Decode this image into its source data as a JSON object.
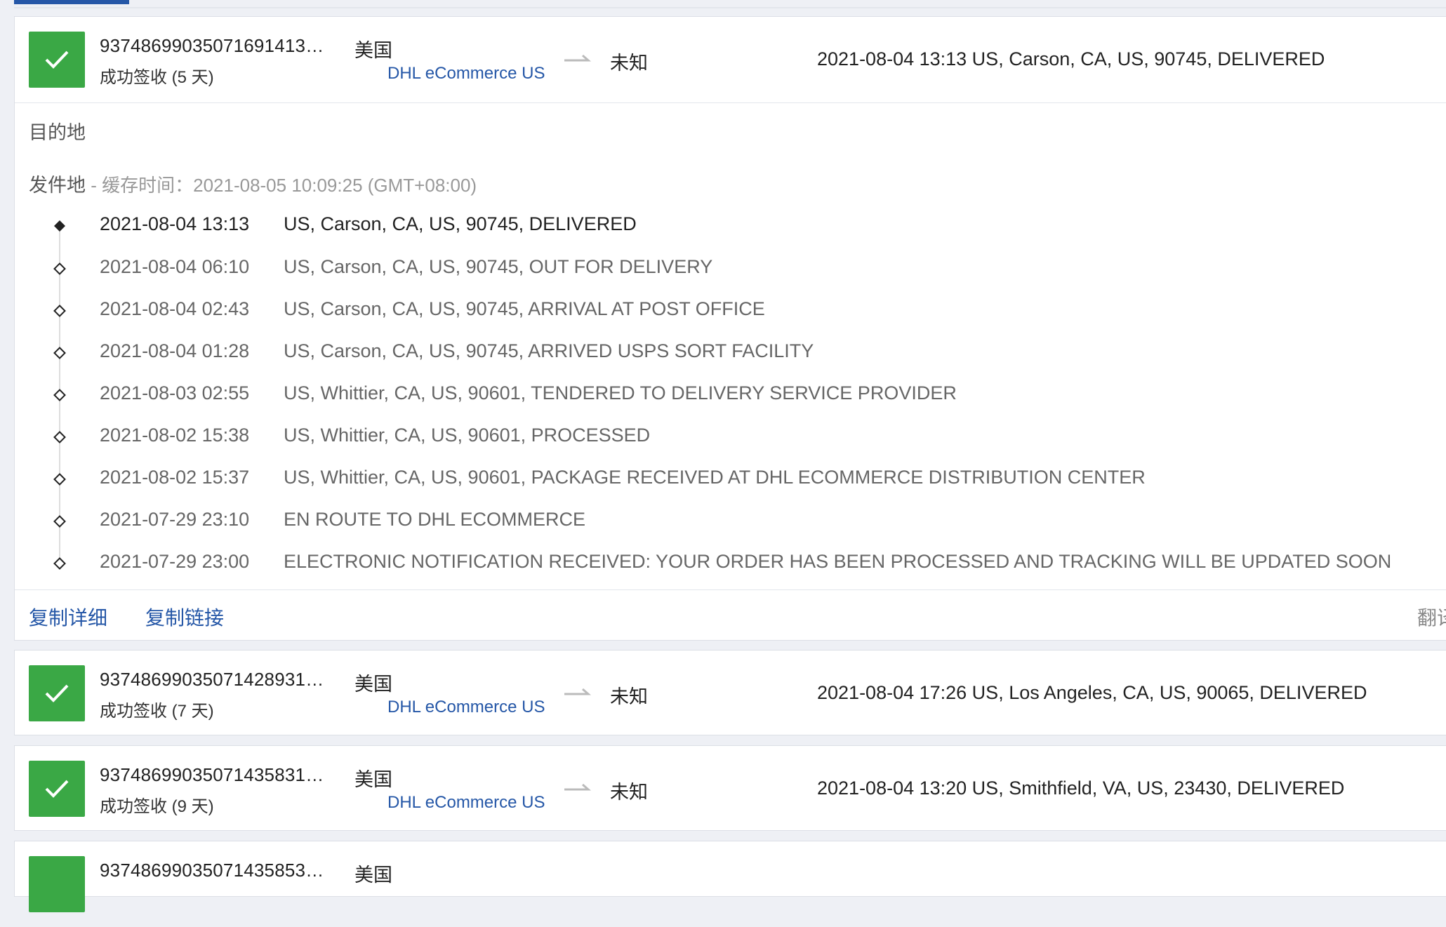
{
  "shipments": [
    {
      "tracking_number": "93748699035071691413…",
      "status": "成功签收 (5 天)",
      "origin_country": "美国",
      "carrier": "DHL eCommerce US",
      "dest_country": "未知",
      "latest_event": "2021-08-04 13:13  US, Carson, CA, US, 90745, DELIVERED"
    },
    {
      "tracking_number": "93748699035071428931…",
      "status": "成功签收 (7 天)",
      "origin_country": "美国",
      "carrier": "DHL eCommerce US",
      "dest_country": "未知",
      "latest_event": "2021-08-04 17:26  US, Los Angeles, CA, US, 90065, DELIVERED"
    },
    {
      "tracking_number": "93748699035071435831…",
      "status": "成功签收 (9 天)",
      "origin_country": "美国",
      "carrier": "DHL eCommerce US",
      "dest_country": "未知",
      "latest_event": "2021-08-04 13:20  US, Smithfield, VA, US, 23430, DELIVERED"
    },
    {
      "tracking_number": "93748699035071435853…",
      "origin_country": "美国"
    }
  ],
  "detail": {
    "destination_label": "目的地",
    "origin_label": "发件地",
    "cache_time": " - 缓存时间：2021-08-05 10:09:25 (GMT+08:00)",
    "events": [
      {
        "time": "2021-08-04 13:13",
        "desc": "US, Carson, CA, US, 90745, DELIVERED"
      },
      {
        "time": "2021-08-04 06:10",
        "desc": "US, Carson, CA, US, 90745, OUT FOR DELIVERY"
      },
      {
        "time": "2021-08-04 02:43",
        "desc": "US, Carson, CA, US, 90745, ARRIVAL AT POST OFFICE"
      },
      {
        "time": "2021-08-04 01:28",
        "desc": "US, Carson, CA, US, 90745, ARRIVED USPS SORT FACILITY"
      },
      {
        "time": "2021-08-03 02:55",
        "desc": "US, Whittier, CA, US, 90601, TENDERED TO DELIVERY SERVICE PROVIDER"
      },
      {
        "time": "2021-08-02 15:38",
        "desc": "US, Whittier, CA, US, 90601, PROCESSED"
      },
      {
        "time": "2021-08-02 15:37",
        "desc": "US, Whittier, CA, US, 90601, PACKAGE RECEIVED AT DHL ECOMMERCE DISTRIBUTION CENTER"
      },
      {
        "time": "2021-07-29 23:10",
        "desc": "EN ROUTE TO DHL ECOMMERCE"
      },
      {
        "time": "2021-07-29 23:00",
        "desc": "ELECTRONIC NOTIFICATION RECEIVED: YOUR ORDER HAS BEEN PROCESSED AND TRACKING WILL BE UPDATED SOON"
      }
    ],
    "copy_detail": "复制详细",
    "copy_link": "复制链接",
    "translate": "翻译"
  },
  "colors": {
    "success": "#3aa845",
    "link": "#2557a7"
  }
}
